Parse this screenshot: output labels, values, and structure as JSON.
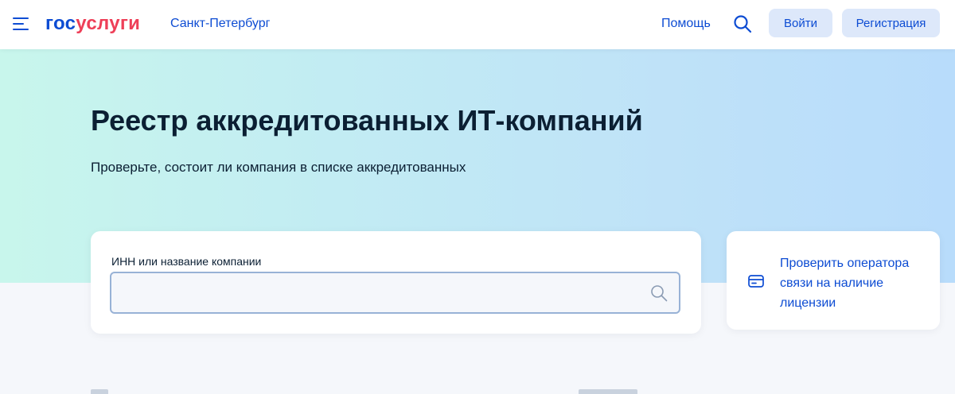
{
  "header": {
    "logo_part1": "гос",
    "logo_part2": "услуги",
    "region": "Санкт-Петербург",
    "help": "Помощь",
    "login": "Войти",
    "register": "Регистрация",
    "brand_color": "#0d4cd3",
    "accent_color": "#ee3f58"
  },
  "hero": {
    "title": "Реестр аккредитованных ИТ-компаний",
    "subtitle": "Проверьте, состоит ли компания в списке аккредитованных"
  },
  "search": {
    "label": "ИНН или название компании",
    "value": "",
    "placeholder": "",
    "icon": "search-icon"
  },
  "side_link": {
    "text": "Проверить оператора связи на наличие лицензии",
    "icon": "wallet-card-icon"
  }
}
